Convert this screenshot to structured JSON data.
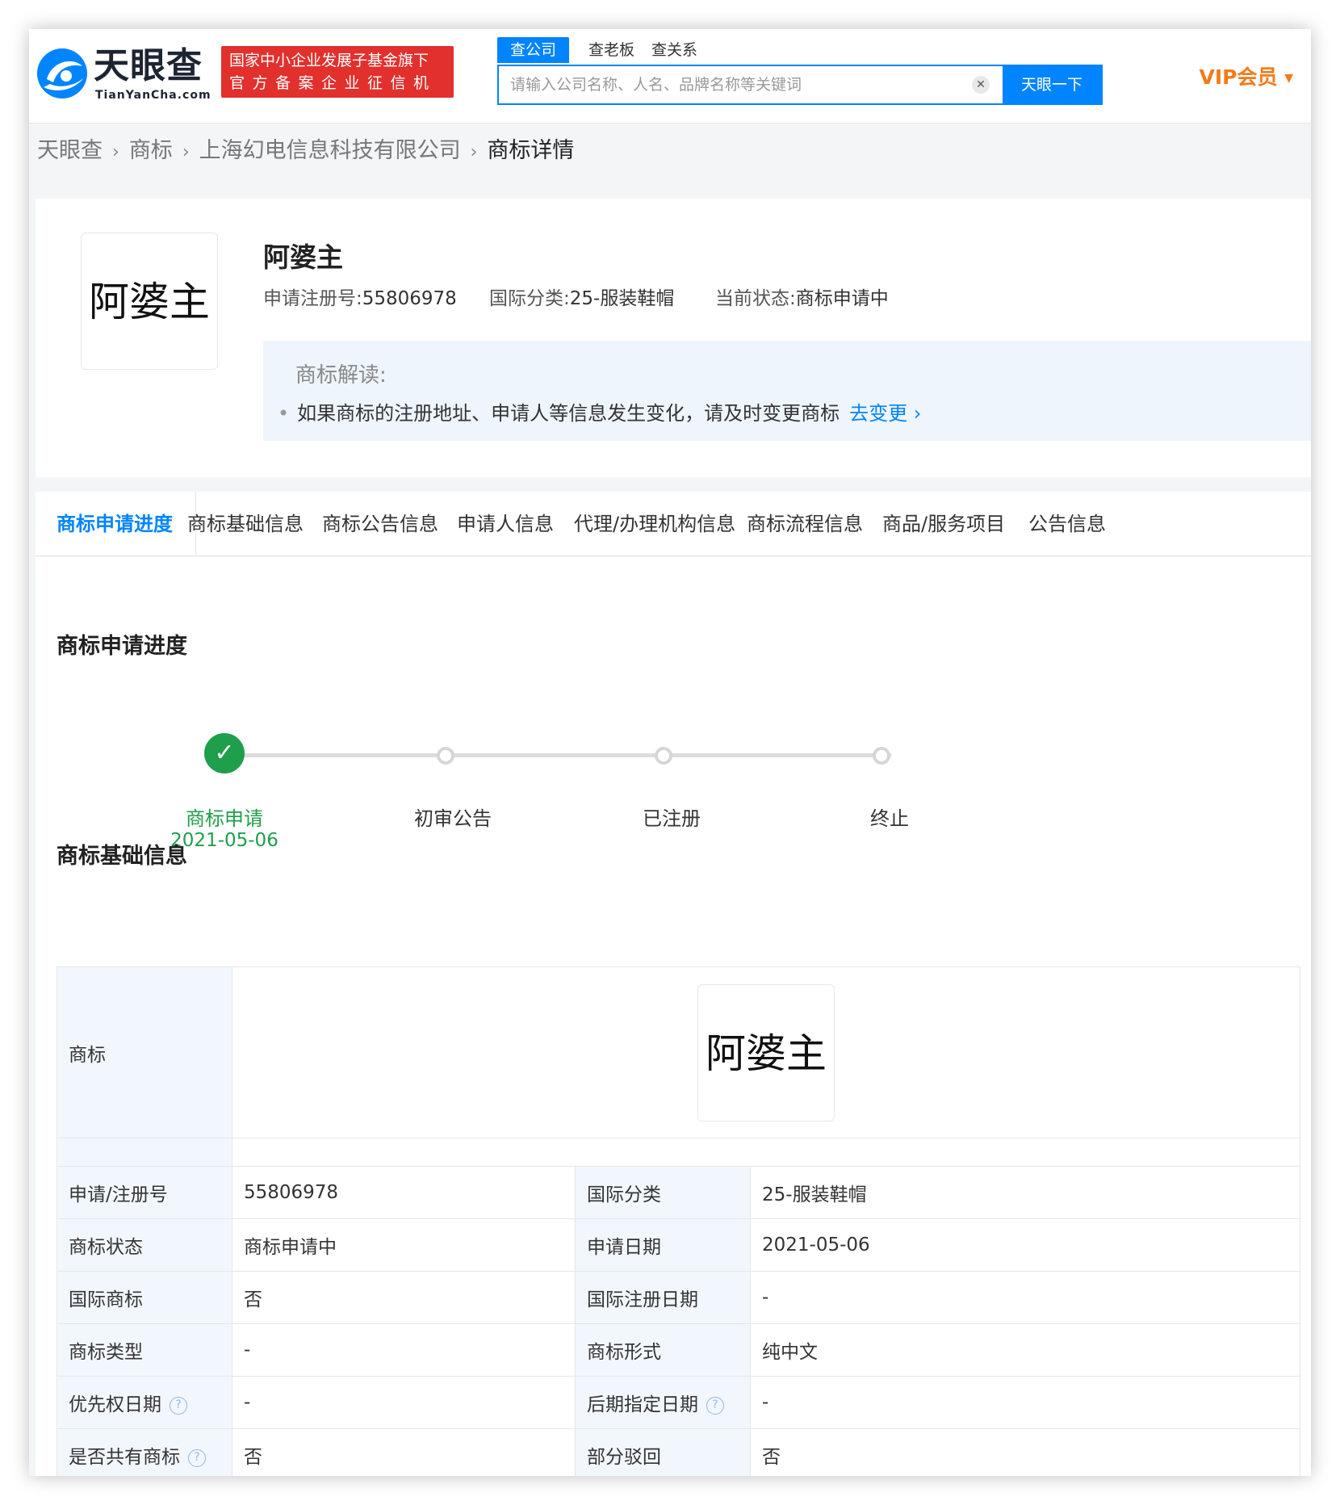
{
  "header": {
    "logo_title": "天眼查",
    "logo_sub": "TianYanCha.com",
    "slogan_line1": "国家中小企业发展子基金旗下",
    "slogan_line2": "官方备案企业征信机构",
    "search_tabs": [
      "查公司",
      "查老板",
      "查关系"
    ],
    "search_placeholder": "请输入公司名称、人名、品牌名称等关键词",
    "search_button": "天眼一下",
    "vip_label": "VIP会员"
  },
  "breadcrumb": [
    "天眼查",
    "商标",
    "上海幻电信息科技有限公司",
    "商标详情"
  ],
  "summary": {
    "trademark_image_text": "阿婆主",
    "trademark_name": "阿婆主",
    "reg_no_label": "申请注册号:",
    "reg_no": "55806978",
    "intl_class_label": "国际分类:",
    "intl_class": "25-服装鞋帽",
    "status_label": "当前状态:",
    "status": "商标申请中",
    "interpret_title": "商标解读:",
    "interpret_text": "如果商标的注册地址、申请人等信息发生变化，请及时变更商标",
    "interpret_link": "去变更"
  },
  "tabs": [
    "商标申请进度",
    "商标基础信息",
    "商标公告信息",
    "申请人信息",
    "代理/办理机构信息",
    "商标流程信息",
    "商品/服务项目",
    "公告信息"
  ],
  "progress": {
    "title": "商标申请进度",
    "steps": [
      {
        "label": "商标申请",
        "date": "2021-05-06",
        "done": true
      },
      {
        "label": "初审公告",
        "date": "",
        "done": false
      },
      {
        "label": "已注册",
        "date": "",
        "done": false
      },
      {
        "label": "终止",
        "date": "",
        "done": false
      }
    ]
  },
  "basic_info": {
    "title": "商标基础信息",
    "trademark_label": "商标",
    "trademark_image_text": "阿婆主",
    "rows": [
      {
        "k1": "申请/注册号",
        "v1": "55806978",
        "k2": "国际分类",
        "v2": "25-服装鞋帽"
      },
      {
        "k1": "商标状态",
        "v1": "商标申请中",
        "k2": "申请日期",
        "v2": "2021-05-06"
      },
      {
        "k1": "国际商标",
        "v1": "否",
        "k2": "国际注册日期",
        "v2": "-"
      },
      {
        "k1": "商标类型",
        "v1": "-",
        "k2": "商标形式",
        "v2": "纯中文"
      },
      {
        "k1": "优先权日期",
        "v1": "-",
        "k2": "后期指定日期",
        "v2": "-"
      },
      {
        "k1": "是否共有商标",
        "v1": "否",
        "k2": "部分驳回",
        "v2": "否"
      }
    ]
  },
  "colors": {
    "brand_blue": "#0084ff",
    "slogan_red": "#e2302d",
    "vip_orange": "#f27b1a",
    "done_green": "#1f9e4b"
  }
}
